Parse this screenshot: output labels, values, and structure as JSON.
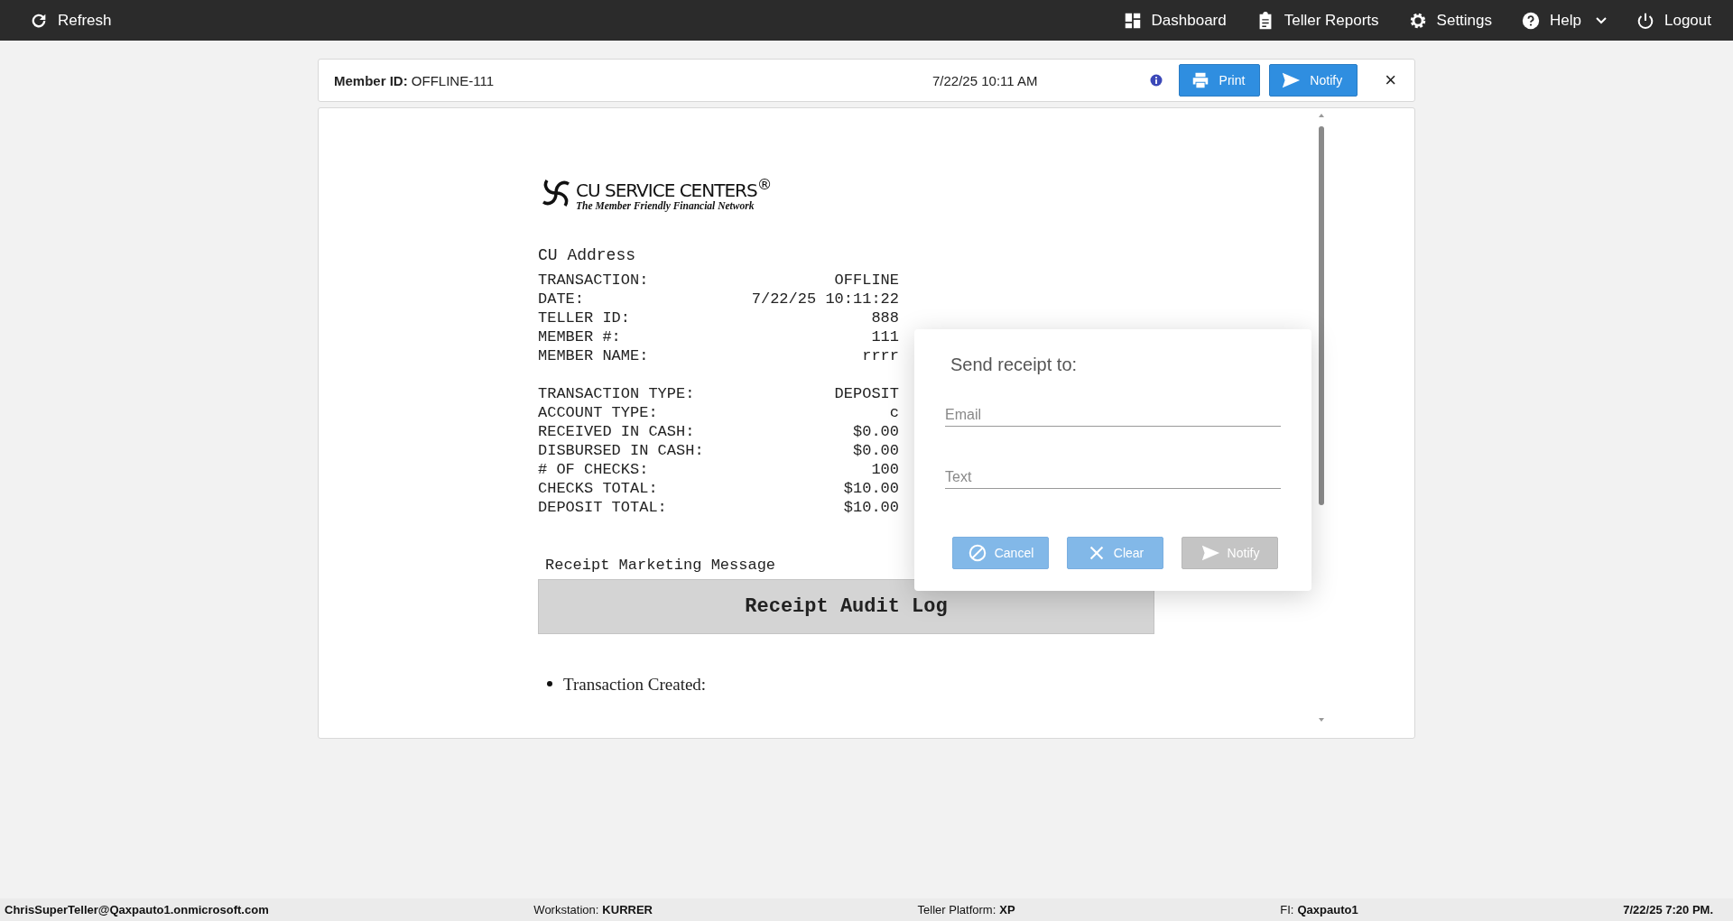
{
  "topbar": {
    "refresh": "Refresh",
    "nav": [
      {
        "kind": "dashboard",
        "label": "Dashboard",
        "caret": false
      },
      {
        "kind": "reports",
        "label": "Teller Reports",
        "caret": false
      },
      {
        "kind": "settings",
        "label": "Settings",
        "caret": false
      },
      {
        "kind": "help",
        "label": "Help",
        "caret": true
      },
      {
        "kind": "logout",
        "label": "Logout",
        "caret": false
      }
    ]
  },
  "header": {
    "member_id_label": "Member ID:",
    "member_id": "OFFLINE-111",
    "datetime": "7/22/25 10:11 AM",
    "buttons": [
      {
        "kind": "print",
        "label": "Print"
      },
      {
        "kind": "notify",
        "label": "Notify"
      }
    ],
    "close": "×"
  },
  "receipt": {
    "logo": {
      "title": "CU SERVICE CENTERS$^{®}$",
      "tagline": "The Member Friendly Financial Network"
    },
    "address": "CU Address",
    "sections": [
      [
        {
          "label": "TRANSACTION:",
          "value": "OFFLINE"
        },
        {
          "label": "DATE:",
          "value": "7/22/25 10:11:22"
        },
        {
          "label": "TELLER ID:",
          "value": "888"
        },
        {
          "label": "MEMBER #:",
          "value": "111"
        },
        {
          "label": "MEMBER NAME:",
          "value": "rrrr"
        }
      ],
      [
        {
          "label": "TRANSACTION TYPE:",
          "value": "DEPOSIT"
        },
        {
          "label": "ACCOUNT TYPE:",
          "value": "c"
        },
        {
          "label": "RECEIVED IN CASH:",
          "value": "$0.00"
        },
        {
          "label": "DISBURSED IN CASH:",
          "value": "$0.00"
        },
        {
          "label": "# OF CHECKS:",
          "value": "100"
        },
        {
          "label": "CHECKS TOTAL:",
          "value": "$10.00"
        },
        {
          "label": "DEPOSIT TOTAL:",
          "value": "$10.00"
        }
      ]
    ],
    "marketing": "Receipt Marketing Message",
    "audit_title": "Receipt Audit Log",
    "audit_items": [
      "Transaction Created:"
    ]
  },
  "dialog": {
    "title": "Send receipt to:",
    "fields": [
      {
        "placeholder": "Email"
      },
      {
        "placeholder": "Text"
      }
    ],
    "buttons": [
      {
        "kind": "cancel",
        "label": "Cancel",
        "disabled": false
      },
      {
        "kind": "clear",
        "label": "Clear",
        "disabled": false
      },
      {
        "kind": "notify",
        "label": "Notify",
        "disabled": true
      }
    ]
  },
  "status_bar": [
    {
      "value": "ChrisSuperTeller@Qaxpauto1.onmicrosoft.com"
    },
    {
      "label": "Workstation:",
      "value": "KURRER"
    },
    {
      "label": "Teller Platform:",
      "value": "XP"
    },
    {
      "label": "FI:",
      "value": "Qaxpauto1"
    },
    {
      "value": "7/22/25 7:20 PM."
    }
  ]
}
